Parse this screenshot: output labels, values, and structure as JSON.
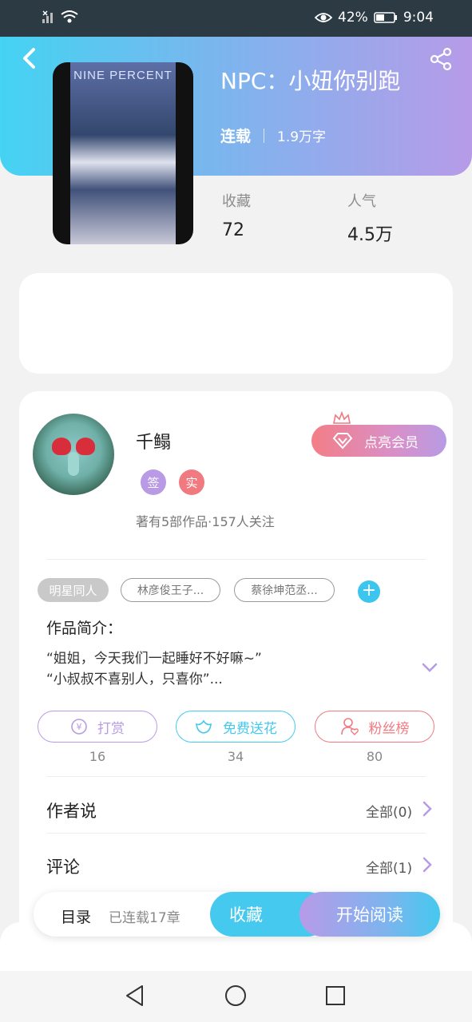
{
  "status_bar": {
    "battery": "42%",
    "time": "9:04"
  },
  "book": {
    "title": "NPC：小妞你别跑",
    "serial_status": "连载",
    "word_count": "1.9万字",
    "cover_text": "NINE PERCENT",
    "stats": [
      {
        "label": "收藏",
        "value": "72"
      },
      {
        "label": "人气",
        "value": "4.5万"
      }
    ]
  },
  "author": {
    "name": "千鳎",
    "badges": [
      {
        "text": "签",
        "color": "#b89be4"
      },
      {
        "text": "实",
        "color": "#f07a80"
      }
    ],
    "meta": "著有5部作品·157人关注",
    "vip_button": "点亮会员"
  },
  "tags": [
    "明星同人",
    "林彦俊王子...",
    "蔡徐坤范丞..."
  ],
  "intro": {
    "label": "作品简介：",
    "lines": [
      "“姐姐，今天我们一起睡好不好嘛~”",
      "“小叔叔不喜别人，只喜你”..."
    ]
  },
  "actions": [
    {
      "label": "打赏",
      "count": "16",
      "color": "#b89be4"
    },
    {
      "label": "免费送花",
      "count": "34",
      "color": "#45c9ee"
    },
    {
      "label": "粉丝榜",
      "count": "80",
      "color": "#f07a80"
    }
  ],
  "sections": [
    {
      "title": "作者说",
      "right": "全部(0)"
    },
    {
      "title": "评论",
      "right": "全部(1)"
    }
  ],
  "bottom_bar": {
    "toc": "目录",
    "chapters": "已连载17章",
    "favorite": "收藏",
    "read": "开始阅读"
  }
}
